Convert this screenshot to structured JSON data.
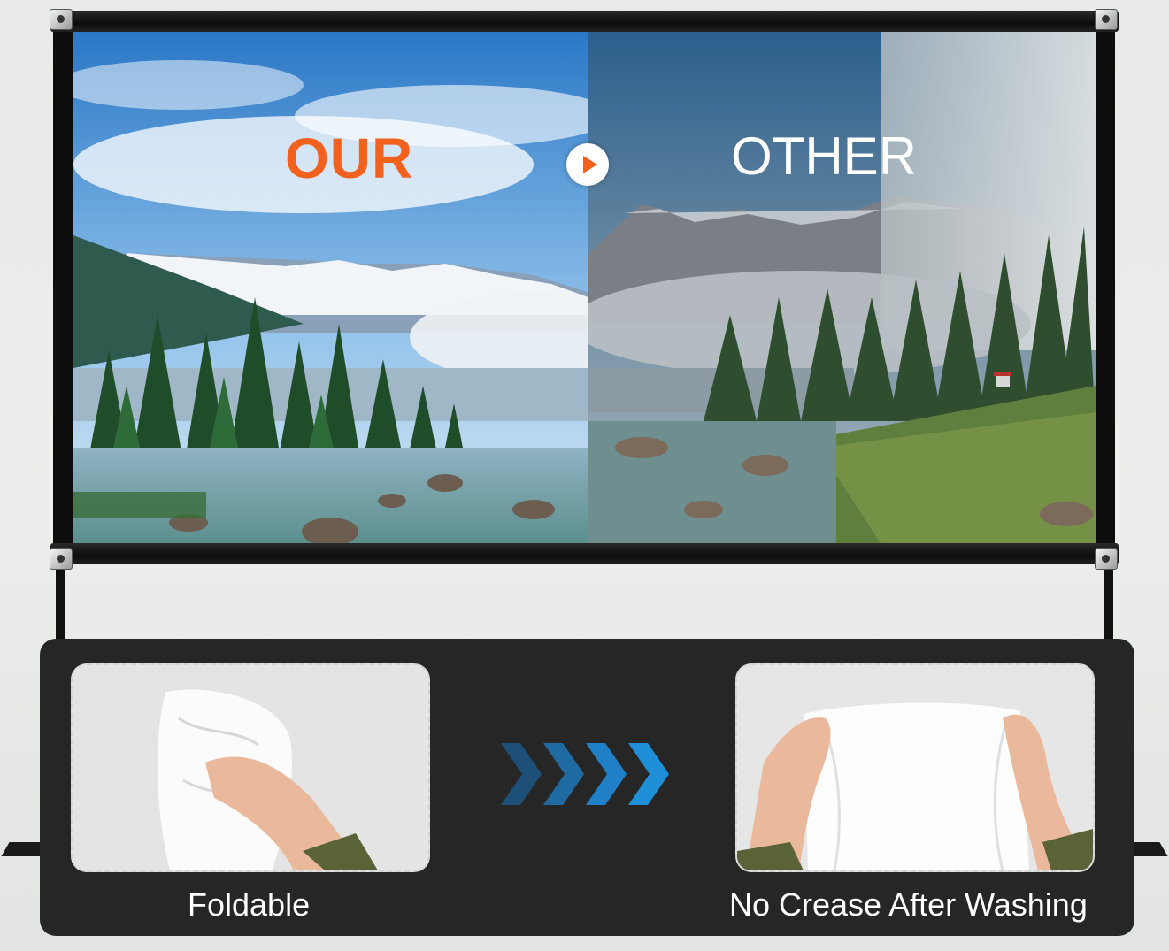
{
  "comparison": {
    "left_label": "OUR",
    "right_label": "OTHER",
    "divider_icon": "play-icon"
  },
  "features": {
    "left_caption": "Foldable",
    "right_caption": "No Crease After Washing",
    "transition_icon": "chevrons-right-icon"
  },
  "colors": {
    "accent": "#f2621e",
    "panel": "#262626",
    "chevron": "#1f8fd8"
  }
}
